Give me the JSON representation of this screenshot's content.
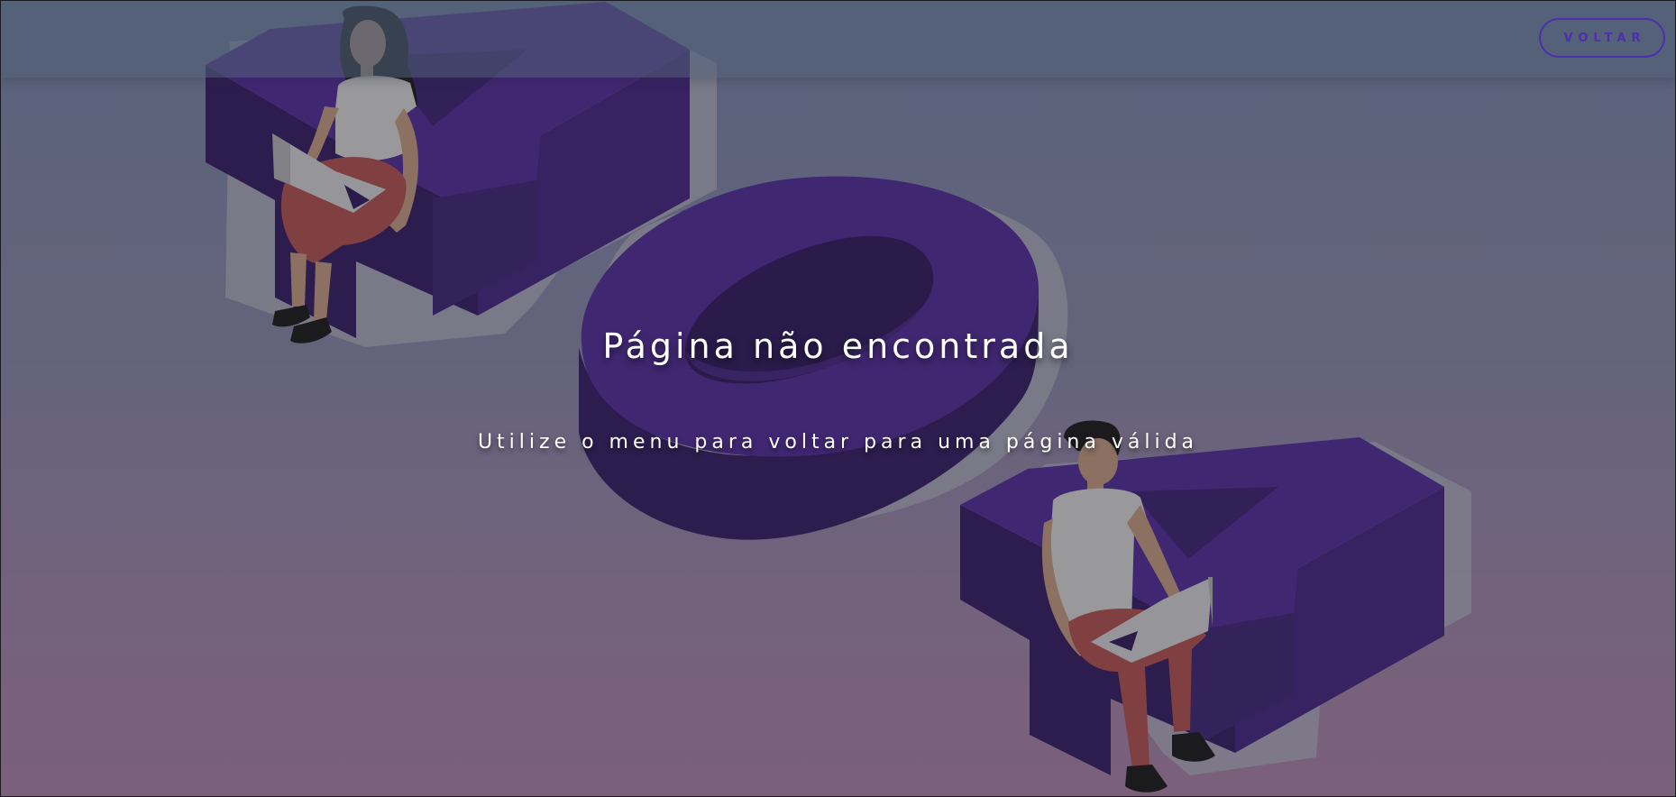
{
  "header": {
    "back_button_label": "VOLTAR"
  },
  "error": {
    "title": "Página não encontrada",
    "message": "Utilize o menu para voltar para uma página válida"
  },
  "illustration": {
    "numerals": [
      "4",
      "0",
      "4"
    ],
    "colors": {
      "numeral_face": "#44277a",
      "numeral_side": "#2e1c52",
      "numeral_shadow": "#8a8a95",
      "skin": "#9a7a68",
      "hair": "#1a1a1a",
      "shirt": "#a9a9aa",
      "pants": "#8c4444",
      "laptop": "#a6a6a8"
    }
  },
  "theme": {
    "accent": "#4a2fb0",
    "text": "#ffffff"
  }
}
